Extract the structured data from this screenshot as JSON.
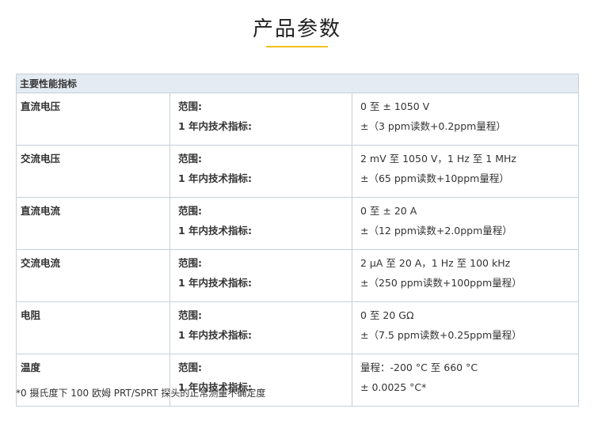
{
  "header": {
    "title": "产品参数",
    "accent_color": "#f2c21a"
  },
  "table": {
    "section_title": "主要性能指标",
    "rows": [
      {
        "category": "直流电压",
        "range_label": "范围:",
        "spec_label": "1 年内技术指标:",
        "range_value": "0 至 ± 1050 V",
        "spec_value": "±（3 ppm读数+0.2ppm量程）"
      },
      {
        "category": "交流电压",
        "range_label": "范围:",
        "spec_label": "1 年内技术指标:",
        "range_value": "2 mV 至 1050 V，1 Hz 至 1 MHz",
        "spec_value": "±（65 ppm读数+10ppm量程）"
      },
      {
        "category": "直流电流",
        "range_label": "范围:",
        "spec_label": "1 年内技术指标:",
        "range_value": "0 至 ± 20 A",
        "spec_value": "±（12 ppm读数+2.0ppm量程）"
      },
      {
        "category": "交流电流",
        "range_label": "范围:",
        "spec_label": "1 年内技术指标:",
        "range_value": "2 μA 至 20 A，1 Hz 至 100 kHz",
        "spec_value": "±（250 ppm读数+100ppm量程）"
      },
      {
        "category": "电阻",
        "range_label": "范围:",
        "spec_label": "1 年内技术指标:",
        "range_value": "0 至 20 GΩ",
        "spec_value": "±（7.5 ppm读数+0.25ppm量程）"
      },
      {
        "category": "温度",
        "range_label": "范围:",
        "spec_label": "1 年内技术指标:",
        "range_value": "量程：-200 °C 至 660 °C",
        "spec_value": "± 0.0025 °C*"
      }
    ]
  },
  "footnote": "*0 摄氏度下 100 欧姆 PRT/SPRT 探头的正常测量不确定度"
}
